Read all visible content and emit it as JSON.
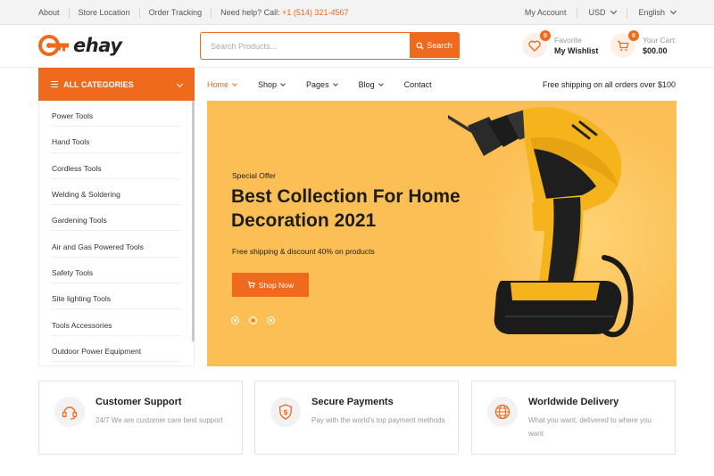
{
  "topbar": {
    "links": [
      "About",
      "Store Location",
      "Order Tracking"
    ],
    "help_label": "Need help? Call: ",
    "help_phone": "+1 (514) 321-4567",
    "account": "My Account",
    "currency": "USD",
    "language": "English"
  },
  "header": {
    "brand": "ehay",
    "search_placeholder": "Search Products...",
    "search_button": "Search",
    "wishlist": {
      "label": "Favorite",
      "value": "My Wishlist",
      "count": "0"
    },
    "cart": {
      "label": "Your Cart:",
      "value": "$00.00",
      "count": "0"
    }
  },
  "categories": {
    "title": "ALL CATEGORIES",
    "items": [
      "Power Tools",
      "Hand Tools",
      "Cordless Tools",
      "Welding & Soldering",
      "Gardening Tools",
      "Air and Gas Powered Tools",
      "Safety Tools",
      "Site lighting Tools",
      "Tools Accessories",
      "Outdoor Power Equipment"
    ]
  },
  "nav": {
    "items": [
      "Home",
      "Shop",
      "Pages",
      "Blog",
      "Contact"
    ],
    "active": "Home",
    "shipping_note": "Free shipping on all orders over $100"
  },
  "hero": {
    "kicker": "Special Offer",
    "title_line1": "Best Collection For Home",
    "title_line2": "Decoration 2021",
    "subtitle": "Free shipping & discount 40% on products",
    "cta": "Shop Now",
    "slides": 3,
    "active_slide": 2
  },
  "features": [
    {
      "icon": "headset-icon",
      "title": "Customer Support",
      "desc": "24/7 We are customer care best support"
    },
    {
      "icon": "shield-dollar-icon",
      "title": "Secure Payments",
      "desc": "Pay with the world's top payment methods"
    },
    {
      "icon": "globe-icon",
      "title": "Worldwide Delivery",
      "desc": "What you want, delivered to where you want"
    }
  ],
  "colors": {
    "accent": "#f06a1d",
    "hero_bg": "#fbbf55",
    "drill_yellow": "#f6b41c"
  }
}
